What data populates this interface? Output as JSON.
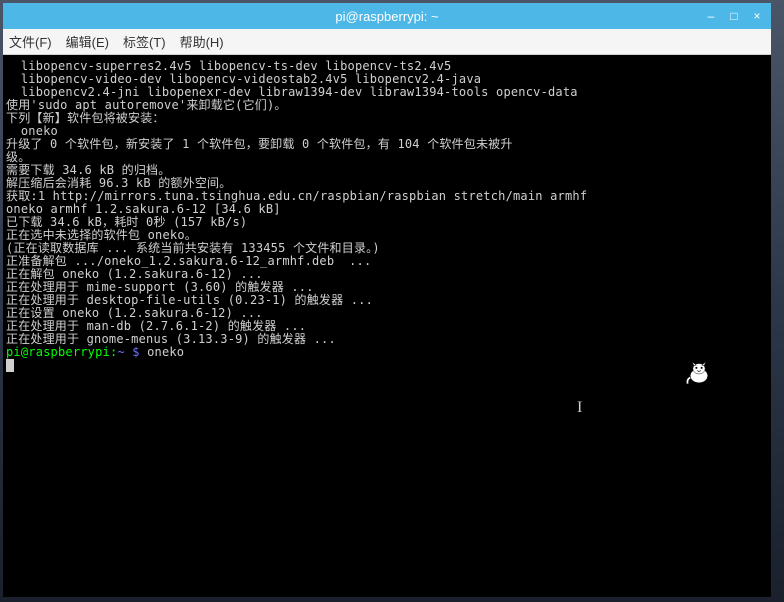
{
  "window": {
    "title": "pi@raspberrypi: ~"
  },
  "controls": {
    "minimize": "–",
    "maximize": "□",
    "close": "×"
  },
  "menu": {
    "file": "文件(F)",
    "edit": "编辑(E)",
    "tabs": "标签(T)",
    "help": "帮助(H)"
  },
  "terminal": {
    "lines": [
      "  libopencv-superres2.4v5 libopencv-ts-dev libopencv-ts2.4v5",
      "  libopencv-video-dev libopencv-videostab2.4v5 libopencv2.4-java",
      "  libopencv2.4-jni libopenexr-dev libraw1394-dev libraw1394-tools opencv-data",
      "使用'sudo apt autoremove'来卸载它(它们)。",
      "下列【新】软件包将被安装：",
      "  oneko",
      "升级了 0 个软件包，新安装了 1 个软件包，要卸载 0 个软件包，有 104 个软件包未被升",
      "级。",
      "需要下载 34.6 kB 的归档。",
      "解压缩后会消耗 96.3 kB 的额外空间。",
      "获取:1 http://mirrors.tuna.tsinghua.edu.cn/raspbian/raspbian stretch/main armhf",
      "oneko armhf 1.2.sakura.6-12 [34.6 kB]",
      "已下载 34.6 kB，耗时 0秒 (157 kB/s)",
      "正在选中未选择的软件包 oneko。",
      "(正在读取数据库 ... 系统当前共安装有 133455 个文件和目录。)",
      "正准备解包 .../oneko_1.2.sakura.6-12_armhf.deb  ...",
      "正在解包 oneko (1.2.sakura.6-12) ...",
      "正在处理用于 mime-support (3.60) 的触发器 ...",
      "正在处理用于 desktop-file-utils (0.23-1) 的触发器 ...",
      "正在设置 oneko (1.2.sakura.6-12) ...",
      "正在处理用于 man-db (2.7.6.1-2) 的触发器 ...",
      "正在处理用于 gnome-menus (3.13.3-9) 的触发器 ..."
    ],
    "prompt": {
      "user_host": "pi@raspberrypi",
      "colon": ":",
      "path": "~",
      "dollar": " $ ",
      "command": "oneko"
    }
  },
  "sprites": {
    "text_cursor": "I",
    "cat_name": "oneko-cat"
  }
}
